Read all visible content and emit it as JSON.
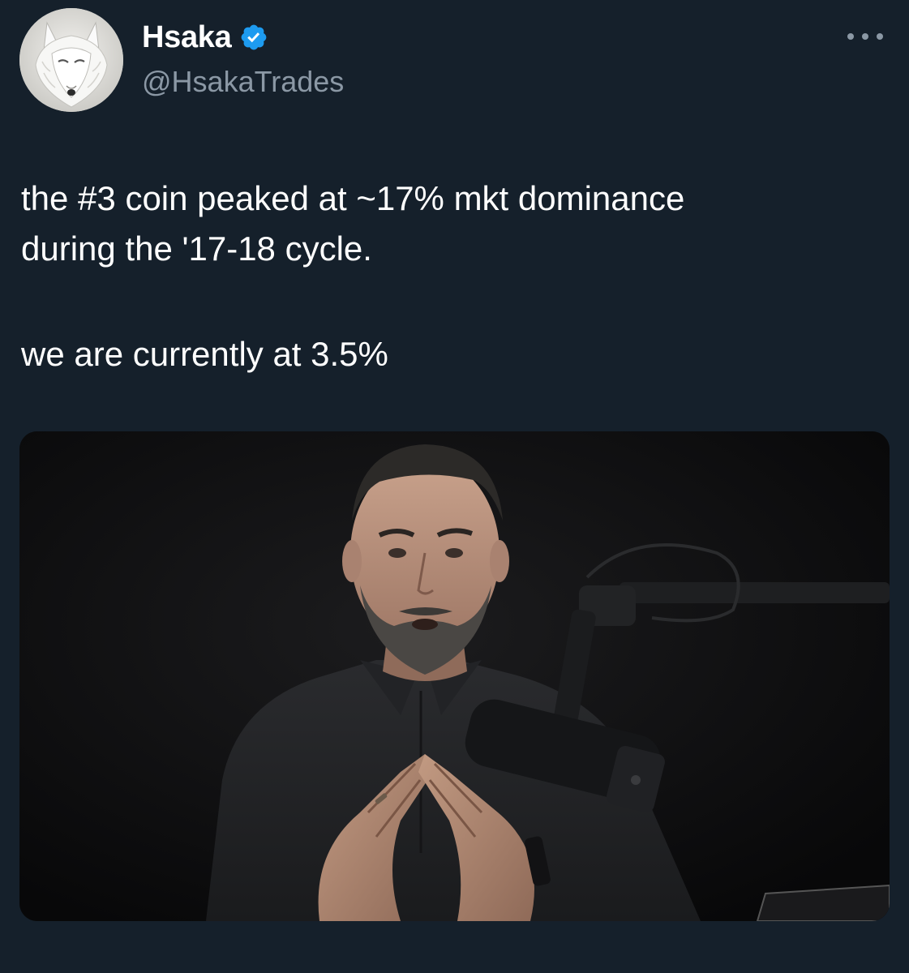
{
  "author": {
    "display_name": "Hsaka",
    "handle": "@HsakaTrades",
    "verified": true,
    "verified_color": "#1d9bf0",
    "avatar_icon": "white-wolf-avatar"
  },
  "tweet": {
    "line_1": "the #3 coin peaked at ~17% mkt dominance",
    "line_2": "during the '17-18 cycle.",
    "line_3": "we are currently at 3.5%"
  },
  "media": {
    "type": "photo",
    "subject": "man-at-podcast-microphone"
  },
  "menu": {
    "icon": "more-horizontal-icon"
  },
  "theme": {
    "background": "#15202b",
    "text": "#ffffff",
    "secondary_text": "#8b98a5"
  }
}
